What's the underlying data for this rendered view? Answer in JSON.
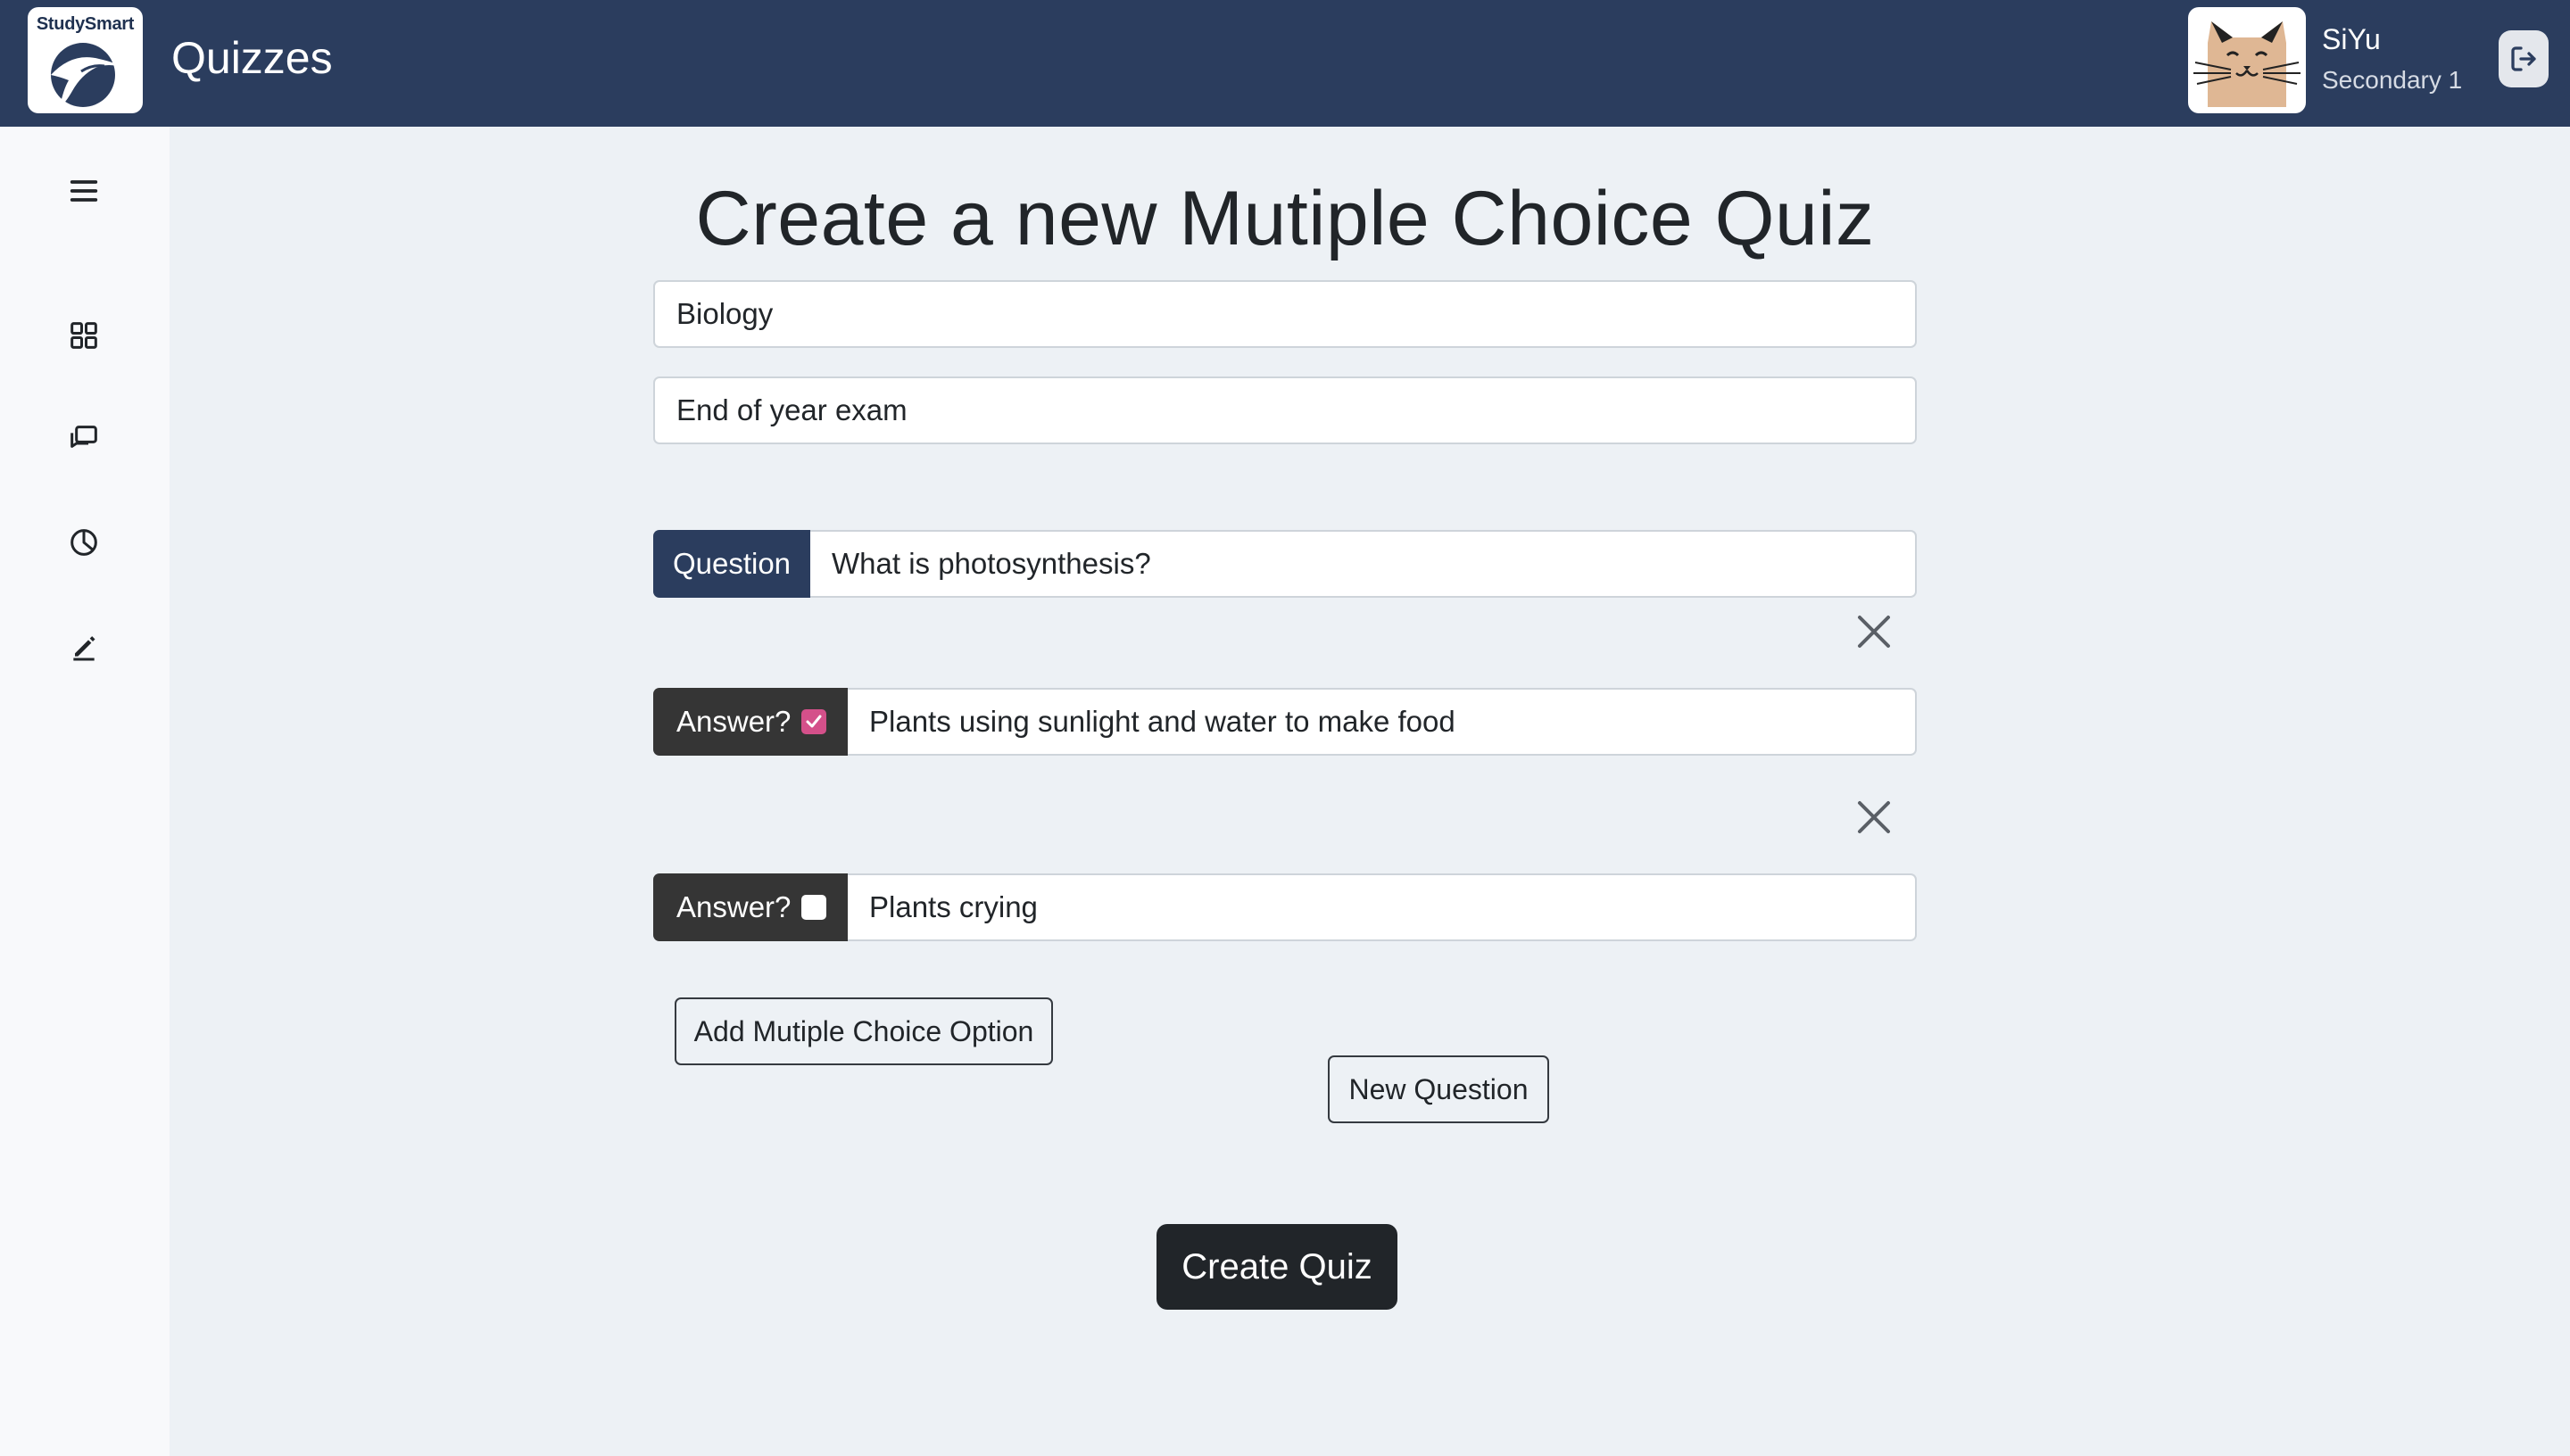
{
  "header": {
    "logo_text": "StudySmart",
    "title": "Quizzes",
    "user_name": "SiYu",
    "user_level": "Secondary 1",
    "logout_icon": "logout-icon",
    "bar_color": "#2b3d5e"
  },
  "sidebar": {
    "items": [
      {
        "icon": "menu-icon"
      },
      {
        "icon": "dashboard-grid-icon"
      },
      {
        "icon": "chat-icon"
      },
      {
        "icon": "pie-chart-icon"
      },
      {
        "icon": "pencil-icon"
      }
    ]
  },
  "form": {
    "heading": "Create a new Mutiple Choice Quiz",
    "subject_value": "Biology",
    "quiz_name_value": "End of year exam",
    "question_label": "Question",
    "question_value": "What is photosynthesis?",
    "answers": [
      {
        "label": "Answer?",
        "checked": true,
        "value": "Plants using sunlight and water to make food"
      },
      {
        "label": "Answer?",
        "checked": false,
        "value": "Plants crying"
      }
    ],
    "add_option_label": "Add Mutiple Choice Option",
    "new_question_label": "New Question",
    "create_label": "Create Quiz",
    "checkbox_color": "#d4508a"
  }
}
